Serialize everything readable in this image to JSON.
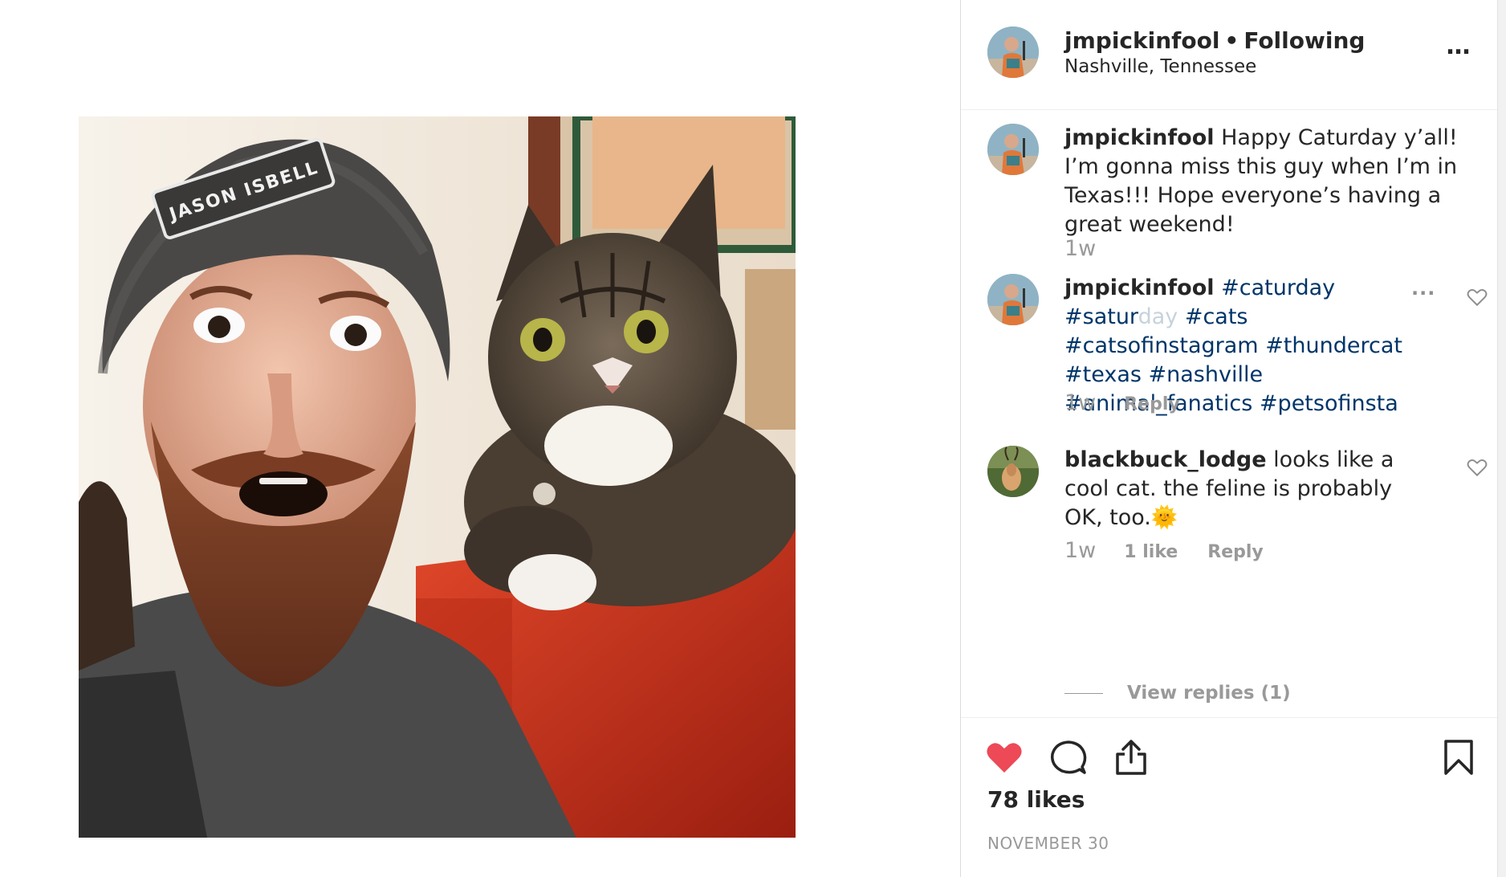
{
  "post": {
    "username": "jmpickinfool",
    "separator": "•",
    "follow_status": "Following",
    "location": "Nashville, Tennessee",
    "more_icon": "…",
    "photo_cap_text": "JASON ISBELL"
  },
  "comments": [
    {
      "username": "jmpickinfool",
      "text": "Happy Caturday y’all! I’m gonna miss this guy when I’m in Texas!!! Hope everyone’s having a great weekend!",
      "time": "1w"
    },
    {
      "username": "jmpickinfool",
      "hashtags": [
        "#caturday",
        "#saturday",
        "#cats",
        "#catsofinstagram",
        "#thundercat",
        "#texas",
        "#nashville",
        "#animal_fanatics",
        "#petsofinsta"
      ],
      "time": "1w",
      "reply_label": "Reply",
      "more_icon": "..."
    },
    {
      "username": "blackbuck_lodge",
      "text": "looks like a cool cat. the feline is probably OK, too.",
      "emoji": "🌞",
      "time": "1w",
      "likes_label": "1 like",
      "reply_label": "Reply",
      "view_replies_label": "View replies (1)"
    }
  ],
  "actions": {
    "likes_label": "78 likes",
    "date": "NOVEMBER 30",
    "like_color": "#ed4956"
  },
  "icons": [
    "heart-filled-icon",
    "comment-icon",
    "share-icon",
    "bookmark-icon",
    "heart-outline-icon",
    "more-icon"
  ]
}
